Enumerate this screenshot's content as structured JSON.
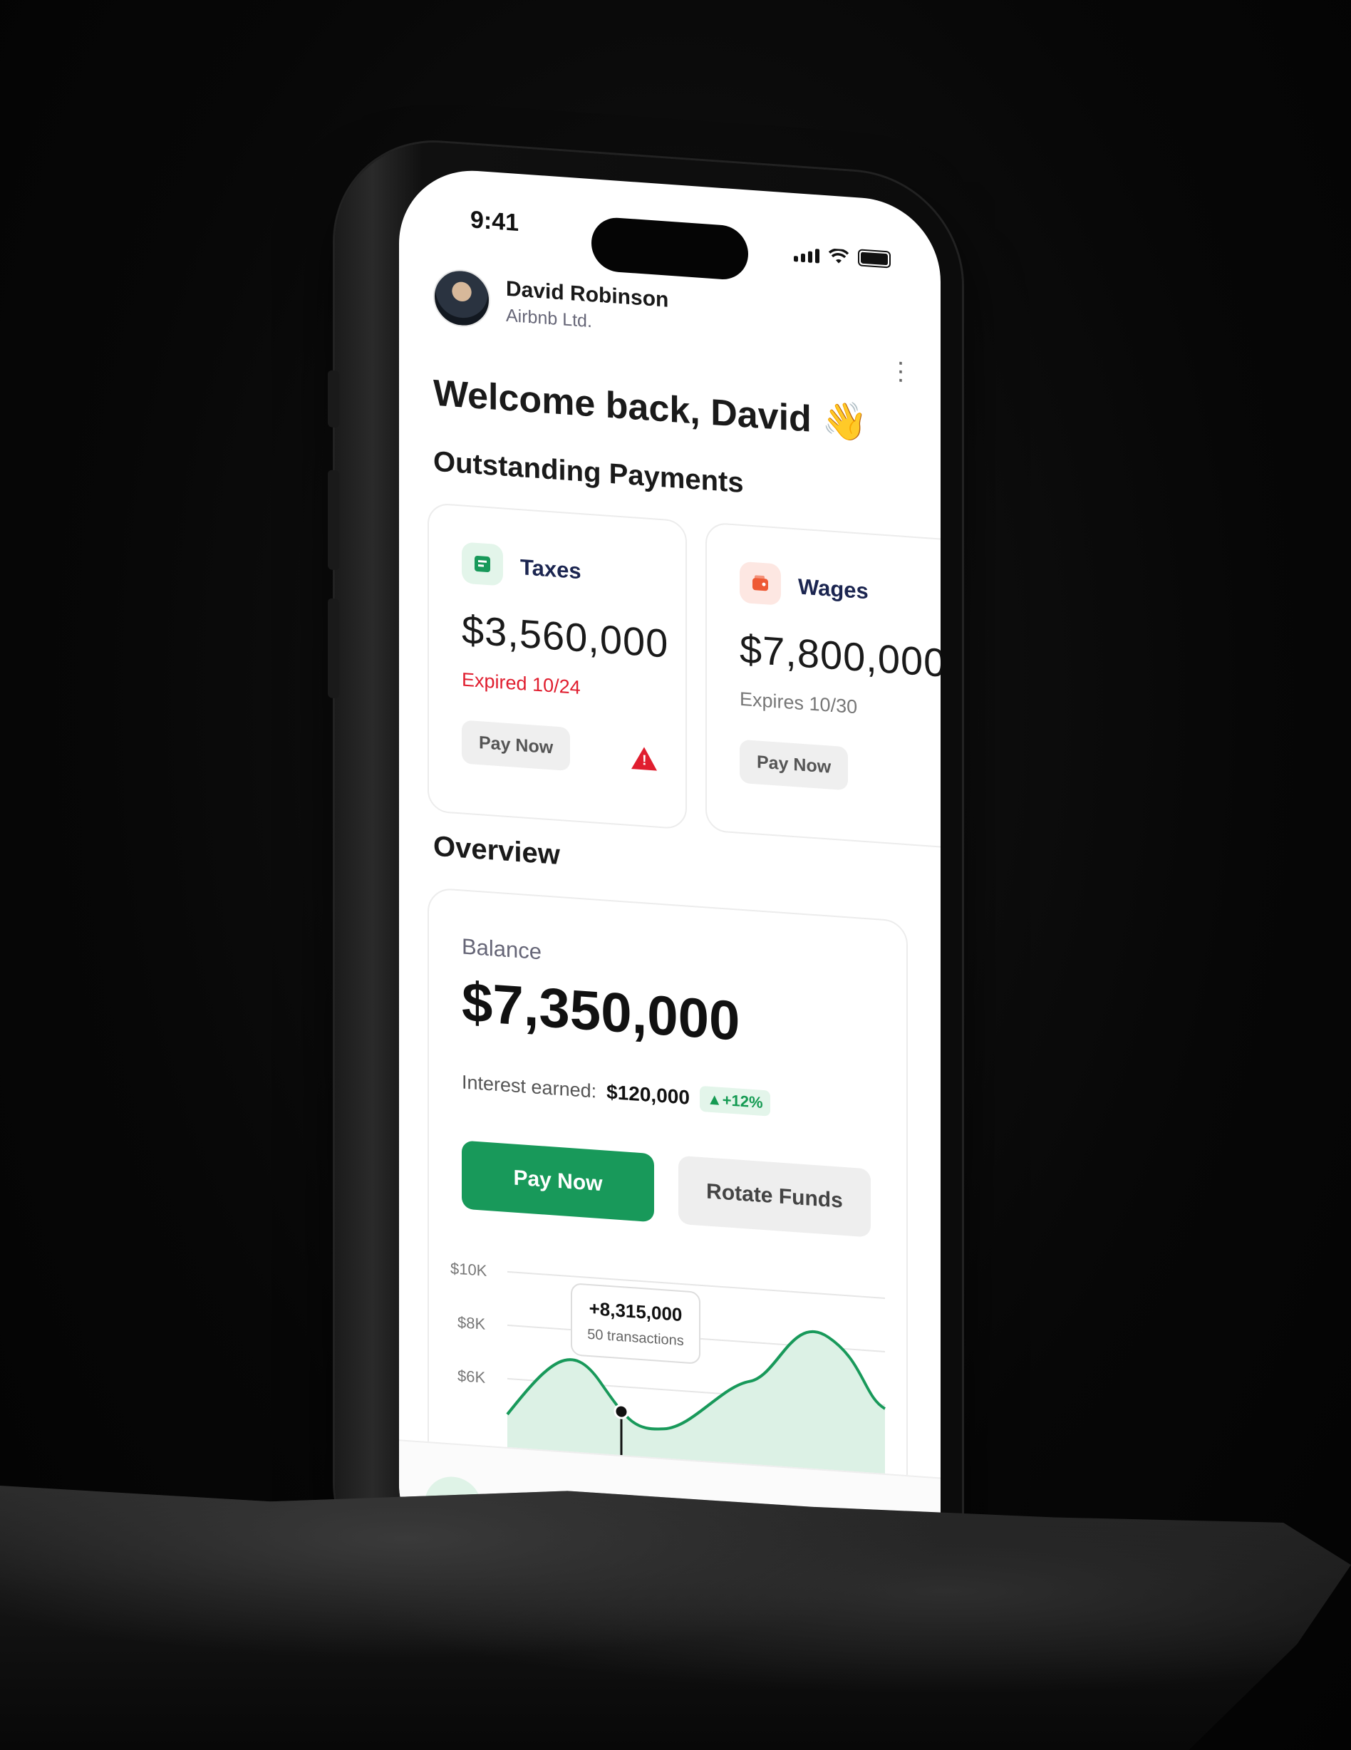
{
  "status": {
    "time": "9:41"
  },
  "profile": {
    "name": "David Robinson",
    "company": "Airbnb Ltd."
  },
  "welcome": "Welcome back, David 👋",
  "outstanding": {
    "title": "Outstanding Payments",
    "cards": [
      {
        "label": "Taxes",
        "amount": "$3,560,000",
        "status": "Expired 10/24",
        "status_color": "#e01e2f",
        "icon_bg": "#e3f5ea",
        "icon_color": "#18995a",
        "button": "Pay Now"
      },
      {
        "label": "Wages",
        "amount": "$7,800,000",
        "status": "Expires 10/30",
        "status_color": "#777777",
        "icon_bg": "#fde7e2",
        "icon_color": "#ee5a35",
        "button": "Pay Now"
      }
    ]
  },
  "overview": {
    "title": "Overview",
    "balance_label": "Balance",
    "balance": "$7,350,000",
    "interest_label": "Interest earned:",
    "interest_value": "$120,000",
    "interest_change": "▲+12%",
    "primary_button": "Pay Now",
    "secondary_button": "Rotate Funds"
  },
  "chart_data": {
    "type": "area",
    "yticks": [
      "$10K",
      "$8K",
      "$6K"
    ],
    "tooltip": {
      "value": "+8,315,000",
      "sub": "50 transactions"
    }
  },
  "colors": {
    "accent": "#18995a",
    "danger": "#e01e2f"
  }
}
